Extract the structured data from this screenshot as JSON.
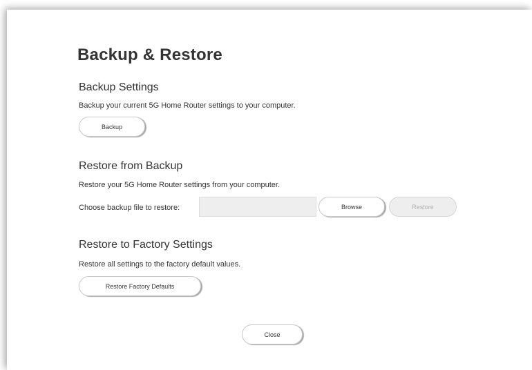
{
  "dialog": {
    "title": "Backup & Restore",
    "close_label": "Close"
  },
  "backup": {
    "heading": "Backup Settings",
    "description": "Backup your current 5G Home Router settings to your computer.",
    "button_label": "Backup"
  },
  "restore": {
    "heading": "Restore from Backup",
    "description": "Restore your 5G Home Router settings from your computer.",
    "file_label": "Choose backup file to restore:",
    "file_value": "",
    "browse_label": "Browse",
    "restore_label": "Restore"
  },
  "factory": {
    "heading": "Restore to Factory Settings",
    "description": "Restore all settings to the factory default values.",
    "button_label": "Restore Factory Defaults"
  }
}
